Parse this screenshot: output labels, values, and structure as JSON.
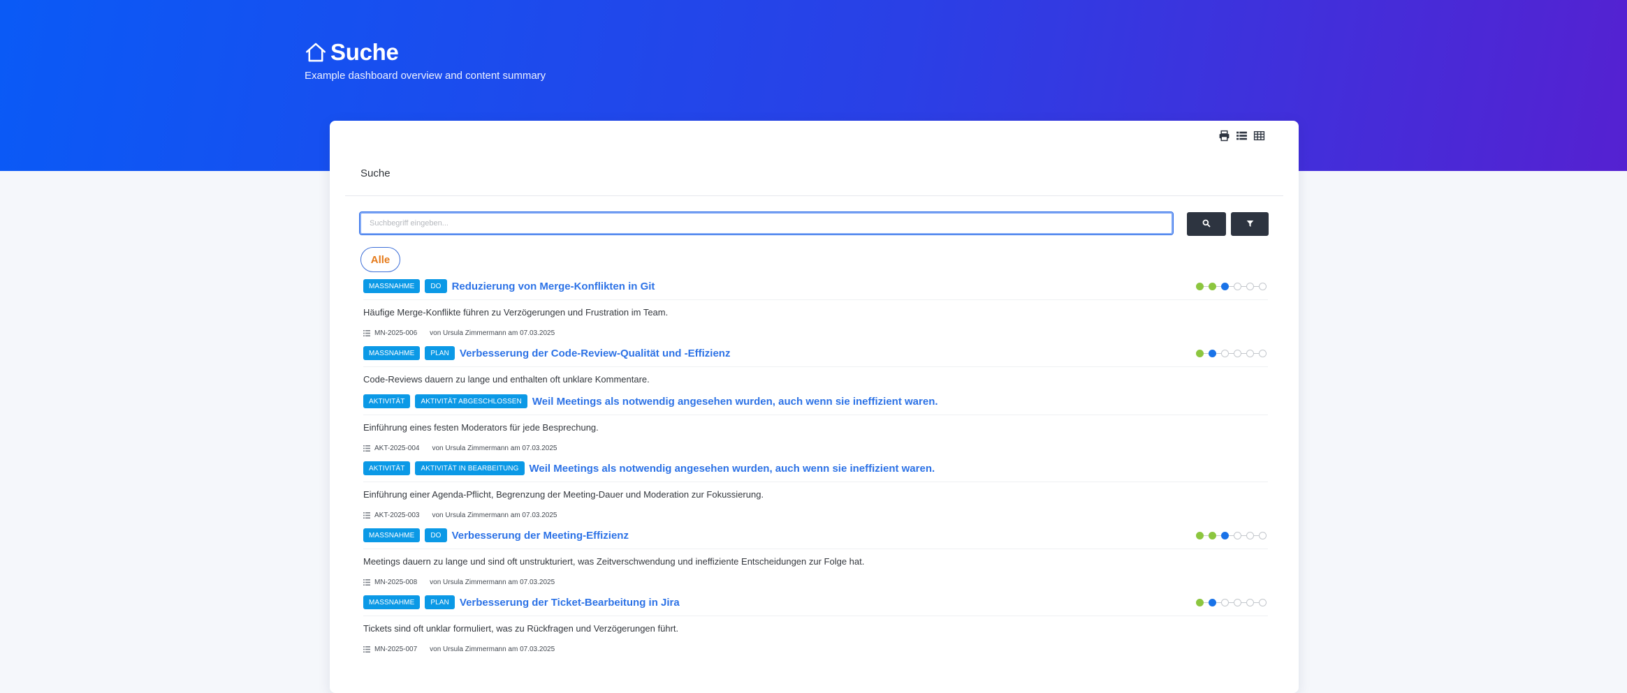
{
  "header": {
    "title": "Suche",
    "subtitle": "Example dashboard overview and content summary"
  },
  "toolbar": {
    "icons": [
      "print-icon",
      "list-view-icon",
      "table-view-icon"
    ]
  },
  "card": {
    "title": "Suche"
  },
  "search": {
    "placeholder": "Suchbegriff eingeben...",
    "value": ""
  },
  "filter": {
    "active_label": "Alle"
  },
  "results": [
    {
      "badges": [
        "MASSNAHME",
        "DO"
      ],
      "title": "Reduzierung von Merge-Konflikten in Git",
      "description": "Häufige Merge-Konflikte führen zu Verzögerungen und Frustration im Team.",
      "ref": "MN-2025-006",
      "meta": "von Ursula Zimmermann am 07.03.2025",
      "progress": {
        "steps": 6,
        "done": 2,
        "current": 3
      }
    },
    {
      "badges": [
        "MASSNAHME",
        "PLAN"
      ],
      "title": "Verbesserung der Code-Review-Qualität und -Effizienz",
      "description": "Code-Reviews dauern zu lange und enthalten oft unklare Kommentare.",
      "ref": "",
      "meta": "",
      "progress": {
        "steps": 6,
        "done": 1,
        "current": 2
      }
    },
    {
      "badges": [
        "AKTIVITÄT",
        "AKTIVITÄT ABGESCHLOSSEN"
      ],
      "title": "Weil Meetings als notwendig angesehen wurden, auch wenn sie ineffizient waren.",
      "description": "Einführung eines festen Moderators für jede Besprechung.",
      "ref": "AKT-2025-004",
      "meta": "von Ursula Zimmermann am 07.03.2025",
      "progress": null
    },
    {
      "badges": [
        "AKTIVITÄT",
        "AKTIVITÄT IN BEARBEITUNG"
      ],
      "title": "Weil Meetings als notwendig angesehen wurden, auch wenn sie ineffizient waren.",
      "description": "Einführung einer Agenda-Pflicht, Begrenzung der Meeting-Dauer und Moderation zur Fokussierung.",
      "ref": "AKT-2025-003",
      "meta": "von Ursula Zimmermann am 07.03.2025",
      "progress": null
    },
    {
      "badges": [
        "MASSNAHME",
        "DO"
      ],
      "title": "Verbesserung der Meeting-Effizienz",
      "description": "Meetings dauern zu lange und sind oft unstrukturiert, was Zeitverschwendung und ineffiziente Entscheidungen zur Folge hat.",
      "ref": "MN-2025-008",
      "meta": "von Ursula Zimmermann am 07.03.2025",
      "progress": {
        "steps": 6,
        "done": 2,
        "current": 3
      }
    },
    {
      "badges": [
        "MASSNAHME",
        "PLAN"
      ],
      "title": "Verbesserung der Ticket-Bearbeitung in Jira",
      "description": "Tickets sind oft unklar formuliert, was zu Rückfragen und Verzögerungen führt.",
      "ref": "MN-2025-007",
      "meta": "von Ursula Zimmermann am 07.03.2025",
      "progress": {
        "steps": 6,
        "done": 1,
        "current": 2
      }
    }
  ]
}
